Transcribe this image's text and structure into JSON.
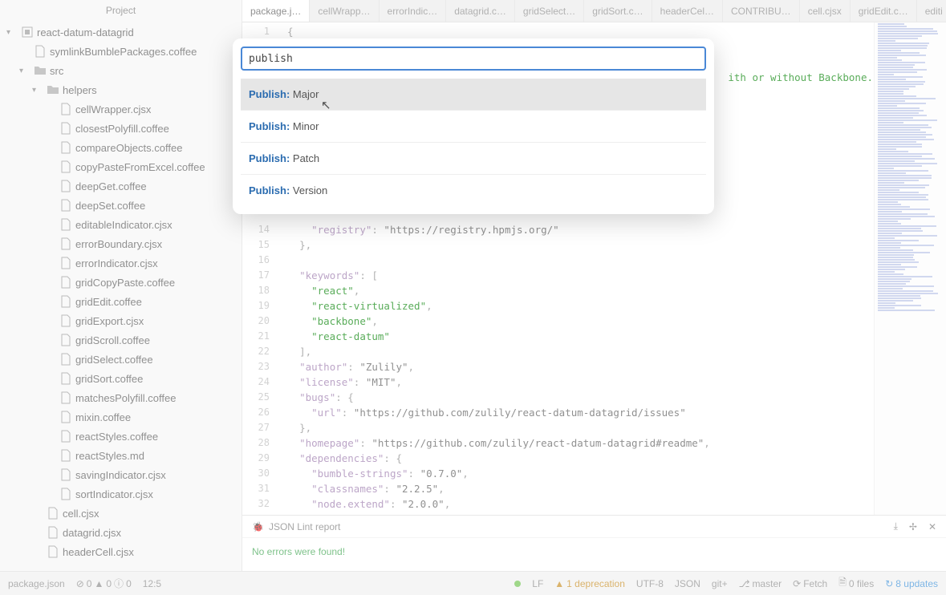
{
  "sidebar": {
    "title": "Project",
    "root": "react-datum-datagrid",
    "rootChild": "symlinkBumblePackages.coffee",
    "src": "src",
    "helpers": "helpers",
    "helperFiles": [
      "cellWrapper.cjsx",
      "closestPolyfill.coffee",
      "compareObjects.coffee",
      "copyPasteFromExcel.coffee",
      "deepGet.coffee",
      "deepSet.coffee",
      "editableIndicator.cjsx",
      "errorBoundary.cjsx",
      "errorIndicator.cjsx",
      "gridCopyPaste.coffee",
      "gridEdit.coffee",
      "gridExport.cjsx",
      "gridScroll.coffee",
      "gridSelect.coffee",
      "gridSort.coffee",
      "matchesPolyfill.coffee",
      "mixin.coffee",
      "reactStyles.coffee",
      "reactStyles.md",
      "savingIndicator.cjsx",
      "sortIndicator.cjsx"
    ],
    "srcFiles": [
      "cell.cjsx",
      "datagrid.cjsx",
      "headerCell.cjsx"
    ]
  },
  "tabs": [
    "package.j…",
    "cellWrapp…",
    "errorIndic…",
    "datagrid.c…",
    "gridSelect…",
    "gridSort.c…",
    "headerCel…",
    "CONTRIBU…",
    "cell.cjsx",
    "gridEdit.c…",
    "editi"
  ],
  "gutter": [
    "1",
    "",
    "",
    "",
    "",
    "",
    "",
    "",
    "",
    "",
    "",
    "",
    "",
    "14",
    "15",
    "16",
    "17",
    "18",
    "19",
    "20",
    "21",
    "22",
    "23",
    "24",
    "25",
    "26",
    "27",
    "28",
    "29",
    "30",
    "31",
    "32"
  ],
  "code": {
    "l1": "{",
    "trail": "ith or without Backbone.js",
    "l14": "    \"registry\": \"https://registry.hpmjs.org/\"",
    "l15": "  },",
    "l16": "",
    "l17": "  \"keywords\": [",
    "l18": "    \"react\",",
    "l19": "    \"react-virtualized\",",
    "l20": "    \"backbone\",",
    "l21": "    \"react-datum\"",
    "l22": "  ],",
    "l23": "  \"author\": \"Zulily\",",
    "l24": "  \"license\": \"MIT\",",
    "l25": "  \"bugs\": {",
    "l26": "    \"url\": \"https://github.com/zulily/react-datum-datagrid/issues\"",
    "l27": "  },",
    "l28": "  \"homepage\": \"https://github.com/zulily/react-datum-datagrid#readme\",",
    "l29": "  \"dependencies\": {",
    "l30": "    \"bumble-strings\": \"0.7.0\",",
    "l31": "    \"classnames\": \"2.2.5\",",
    "l32": "    \"node.extend\": \"2.0.0\","
  },
  "palette": {
    "query": "publish",
    "category": "Publish:",
    "items": [
      "Major",
      "Minor",
      "Patch",
      "Version"
    ]
  },
  "lint": {
    "title": "JSON Lint report",
    "msg": "No errors were found!"
  },
  "status": {
    "file": "package.json",
    "errors": "0",
    "warnings": "0",
    "info": "0",
    "pos": "12:5",
    "eol": "LF",
    "deprecation": "1 deprecation",
    "enc": "UTF-8",
    "lang": "JSON",
    "git": "git+",
    "branch": "master",
    "fetch": "Fetch",
    "files": "0 files",
    "updates": "8 updates"
  }
}
